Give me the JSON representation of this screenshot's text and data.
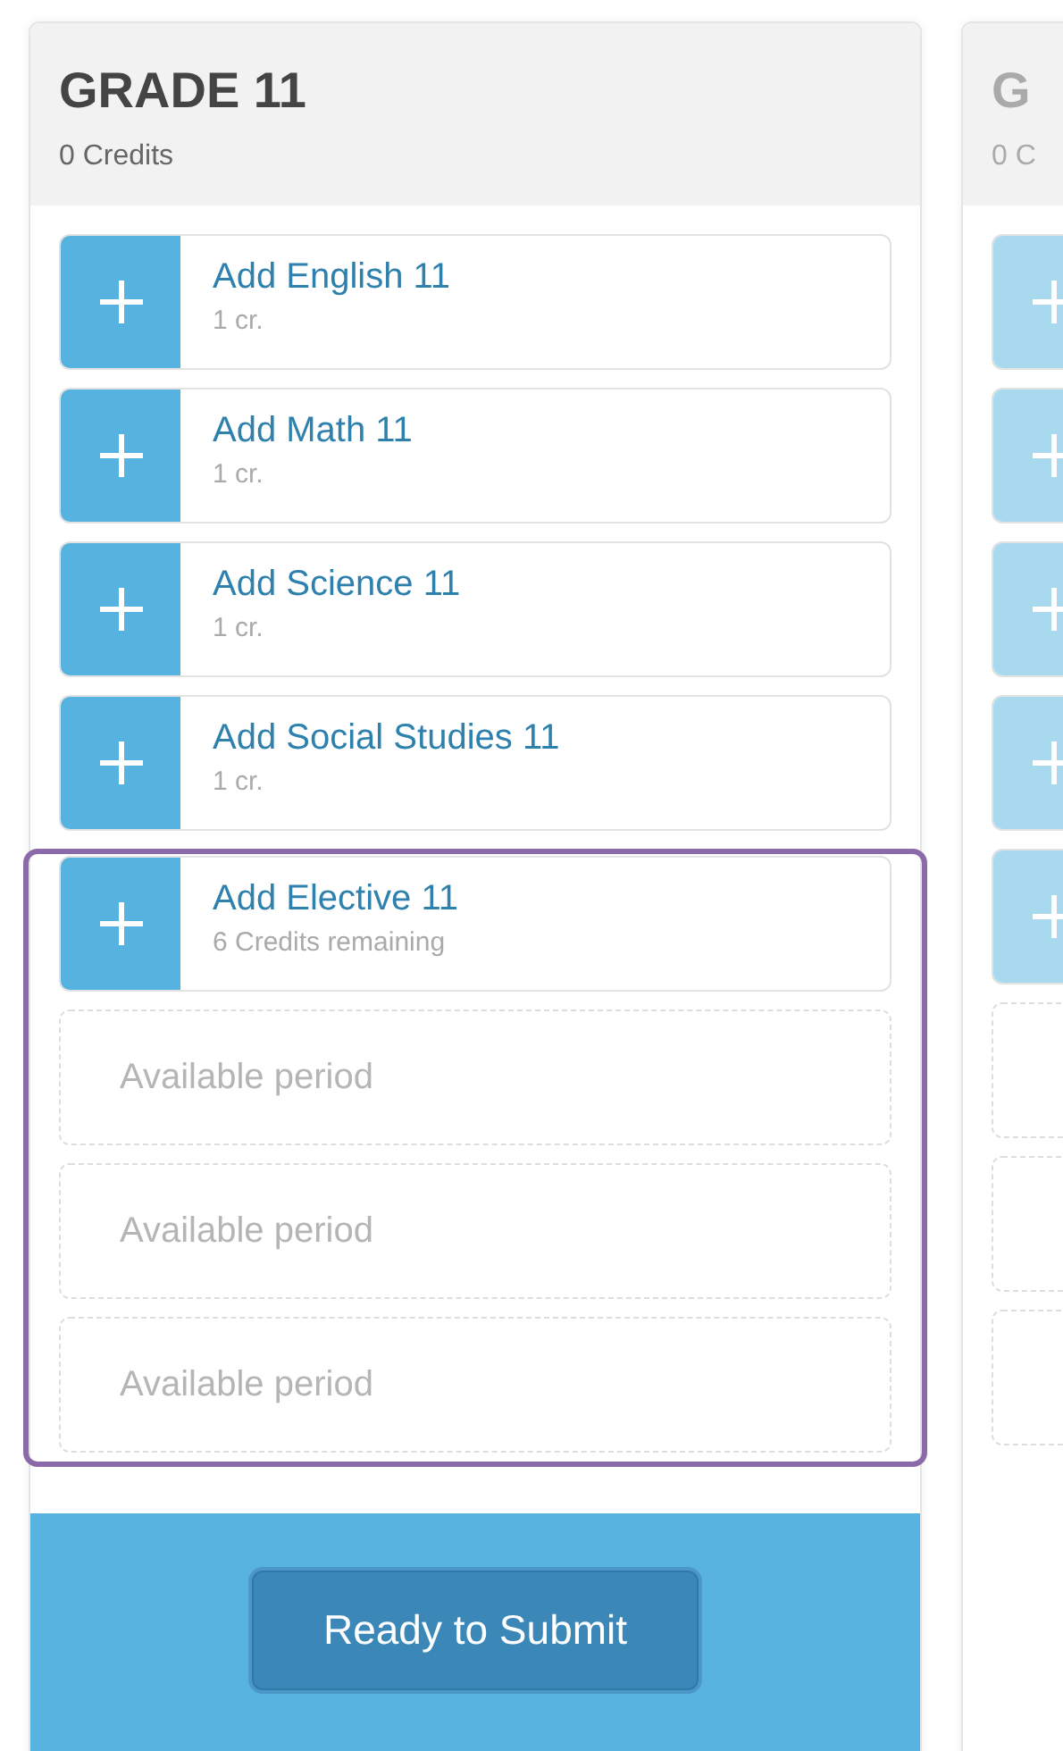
{
  "columns": [
    {
      "title": "GRADE 11",
      "credits": "0 Credits",
      "active": true,
      "courses": [
        {
          "name": "Add English 11",
          "credits": "1 cr."
        },
        {
          "name": "Add Math 11",
          "credits": "1 cr."
        },
        {
          "name": "Add Science 11",
          "credits": "1 cr."
        },
        {
          "name": "Add Social Studies 11",
          "credits": "1 cr."
        }
      ],
      "elective": {
        "highlighted": true,
        "name": "Add Elective 11",
        "credits": "6 Credits remaining",
        "periods": [
          "Available period",
          "Available period",
          "Available period"
        ]
      },
      "submit_button": "Ready to Submit"
    },
    {
      "title": "G",
      "credits": "0 C",
      "active": false
    }
  ]
}
